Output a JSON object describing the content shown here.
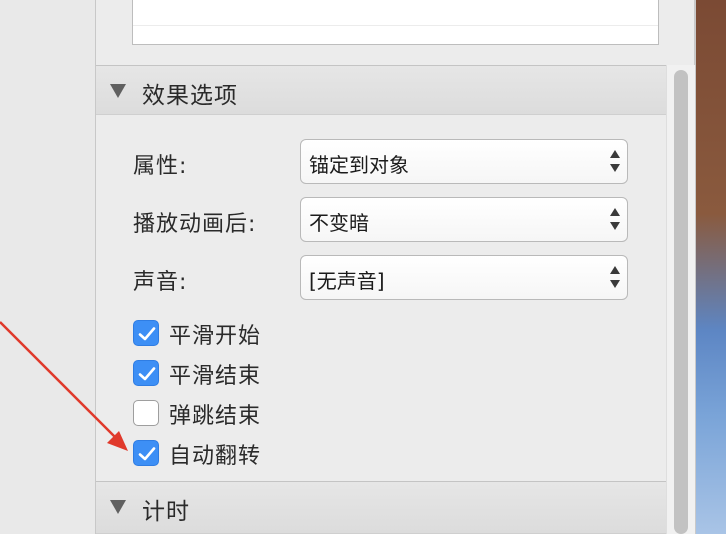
{
  "panel": {
    "effect_options": {
      "title": "效果选项",
      "properties": [
        {
          "label": "属性:",
          "value": "锚定到对象"
        },
        {
          "label": "播放动画后:",
          "value": "不变暗"
        },
        {
          "label": "声音:",
          "value": "[无声音]"
        }
      ],
      "checkboxes": [
        {
          "label": "平滑开始",
          "checked": true
        },
        {
          "label": "平滑结束",
          "checked": true
        },
        {
          "label": "弹跳结束",
          "checked": false
        },
        {
          "label": "自动翻转",
          "checked": true
        }
      ]
    },
    "timing": {
      "title": "计时"
    }
  },
  "colors": {
    "checkbox_accent": "#3d8ff5",
    "annotation_arrow": "#e0392b"
  },
  "icons": {
    "disclosure": "triangle-down-icon",
    "checkmark": "checkmark-icon",
    "stepper": "up-down-chevron-icon"
  }
}
